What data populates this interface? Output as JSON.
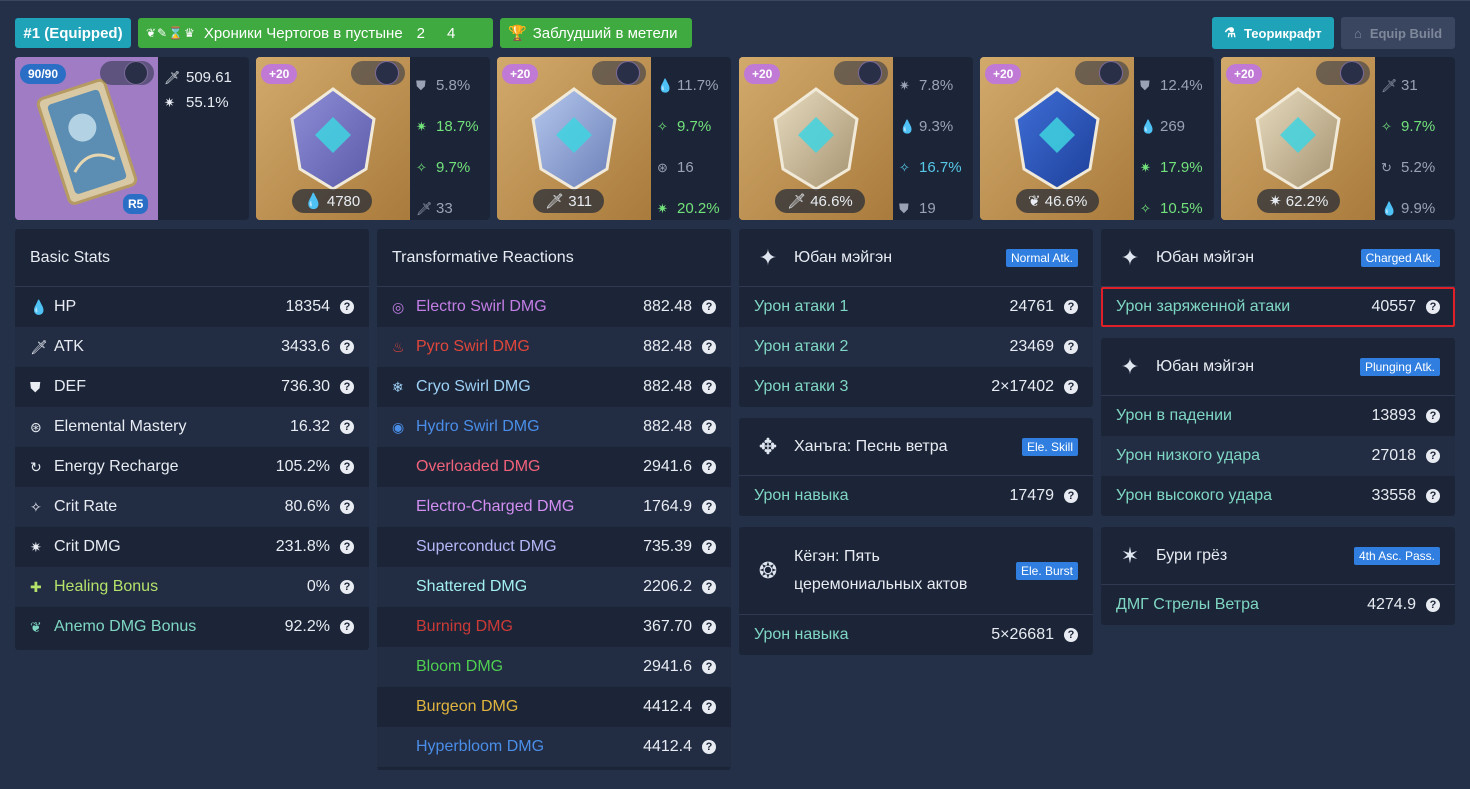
{
  "header": {
    "equipped_tag": "#1 (Equipped)",
    "set_tag": {
      "icons": "❦✎⌛♛",
      "name": "Хроники Чертогов в пустыне",
      "count_a": "2",
      "count_b": "4"
    },
    "cup_tag": {
      "icon": "🏆",
      "name": "Заблудший в метели"
    },
    "theorycraft_button": "Теорикрафт",
    "equip_build_button": "Equip Build"
  },
  "weapon": {
    "level": "90/90",
    "refinement": "R5",
    "atk": "509.61",
    "crit_dmg": "55.1%"
  },
  "artifacts": [
    {
      "level": "+20",
      "main": "4780",
      "main_icon": "hp-icon",
      "subs": [
        {
          "icon": "def-icon",
          "value": "5.8%",
          "style": "dim"
        },
        {
          "icon": "crit-dmg-icon",
          "value": "18.7%",
          "style": "hi"
        },
        {
          "icon": "crit-rate-icon",
          "value": "9.7%",
          "style": "hi"
        },
        {
          "icon": "atk-icon",
          "value": "33",
          "style": "dim"
        }
      ]
    },
    {
      "level": "+20",
      "main": "311",
      "main_icon": "atk-icon",
      "subs": [
        {
          "icon": "hp-icon",
          "value": "11.7%",
          "style": "dim"
        },
        {
          "icon": "crit-rate-icon",
          "value": "9.7%",
          "style": "hi"
        },
        {
          "icon": "em-icon",
          "value": "16",
          "style": "dim"
        },
        {
          "icon": "crit-dmg-icon",
          "value": "20.2%",
          "style": "hi"
        }
      ]
    },
    {
      "level": "+20",
      "main": "46.6%",
      "main_icon": "atk-icon",
      "subs": [
        {
          "icon": "crit-dmg-icon",
          "value": "7.8%",
          "style": "dim"
        },
        {
          "icon": "hp-icon",
          "value": "9.3%",
          "style": "dim"
        },
        {
          "icon": "crit-rate-icon",
          "value": "16.7%",
          "style": "hi2"
        },
        {
          "icon": "def-icon",
          "value": "19",
          "style": "dim"
        }
      ]
    },
    {
      "level": "+20",
      "main": "46.6%",
      "main_icon": "anemo-icon",
      "subs": [
        {
          "icon": "def-icon",
          "value": "12.4%",
          "style": "dim"
        },
        {
          "icon": "hp-icon",
          "value": "269",
          "style": "dim"
        },
        {
          "icon": "crit-dmg-icon",
          "value": "17.9%",
          "style": "hi"
        },
        {
          "icon": "crit-rate-icon",
          "value": "10.5%",
          "style": "hi"
        }
      ]
    },
    {
      "level": "+20",
      "main": "62.2%",
      "main_icon": "crit-dmg-icon",
      "subs": [
        {
          "icon": "atk-icon",
          "value": "31",
          "style": "dim"
        },
        {
          "icon": "crit-rate-icon",
          "value": "9.7%",
          "style": "hi"
        },
        {
          "icon": "er-icon",
          "value": "5.2%",
          "style": "dim"
        },
        {
          "icon": "hp-icon",
          "value": "9.9%",
          "style": "dim"
        }
      ]
    }
  ],
  "basic_stats": {
    "title": "Basic Stats",
    "rows": [
      {
        "icon": "hp-icon",
        "label": "HP",
        "value": "18354",
        "color": "#e8ecf2"
      },
      {
        "icon": "atk-icon",
        "label": "ATK",
        "value": "3433.6",
        "color": "#e8ecf2"
      },
      {
        "icon": "def-icon",
        "label": "DEF",
        "value": "736.30",
        "color": "#e8ecf2"
      },
      {
        "icon": "em-icon",
        "label": "Elemental Mastery",
        "value": "16.32",
        "color": "#e8ecf2"
      },
      {
        "icon": "er-icon",
        "label": "Energy Recharge",
        "value": "105.2%",
        "color": "#e8ecf2"
      },
      {
        "icon": "crit-rate-icon",
        "label": "Crit Rate",
        "value": "80.6%",
        "color": "#e8ecf2"
      },
      {
        "icon": "crit-dmg-icon",
        "label": "Crit DMG",
        "value": "231.8%",
        "color": "#e8ecf2"
      },
      {
        "icon": "healing-icon",
        "label": "Healing Bonus",
        "value": "0%",
        "color": "#b4e26a"
      },
      {
        "icon": "anemo-icon",
        "label": "Anemo DMG Bonus",
        "value": "92.2%",
        "color": "#7fd7c3"
      }
    ]
  },
  "reactions": {
    "title": "Transformative Reactions",
    "rows": [
      {
        "icon": "electro-swirl-icon",
        "label": "Electro Swirl DMG",
        "value": "882.48",
        "color": "#c37ee6"
      },
      {
        "icon": "pyro-swirl-icon",
        "label": "Pyro Swirl DMG",
        "value": "882.48",
        "color": "#e0463a"
      },
      {
        "icon": "cryo-swirl-icon",
        "label": "Cryo Swirl DMG",
        "value": "882.48",
        "color": "#9ed0f5"
      },
      {
        "icon": "hydro-swirl-icon",
        "label": "Hydro Swirl DMG",
        "value": "882.48",
        "color": "#4a8ee8"
      },
      {
        "icon": "",
        "label": "Overloaded DMG",
        "value": "2941.6",
        "color": "#f2627a"
      },
      {
        "icon": "",
        "label": "Electro-Charged DMG",
        "value": "1764.9",
        "color": "#d38ff2"
      },
      {
        "icon": "",
        "label": "Superconduct DMG",
        "value": "735.39",
        "color": "#b4b8f8"
      },
      {
        "icon": "",
        "label": "Shattered DMG",
        "value": "2206.2",
        "color": "#a3f0f0"
      },
      {
        "icon": "",
        "label": "Burning DMG",
        "value": "367.70",
        "color": "#cc3a36"
      },
      {
        "icon": "",
        "label": "Bloom DMG",
        "value": "2941.6",
        "color": "#4fcf4f"
      },
      {
        "icon": "",
        "label": "Burgeon DMG",
        "value": "4412.4",
        "color": "#e0b43e"
      },
      {
        "icon": "",
        "label": "Hyperbloom DMG",
        "value": "4412.4",
        "color": "#4a8ee8"
      }
    ]
  },
  "talents": [
    {
      "name": "Юбан мэйгэн",
      "badge": "Normal Atk.",
      "icon": "bow-talent-icon",
      "rows": [
        {
          "label": "Урон атаки 1",
          "value": "24761"
        },
        {
          "label": "Урон атаки 2",
          "value": "23469"
        },
        {
          "label": "Урон атаки 3",
          "value": "2×17402"
        }
      ]
    },
    {
      "name": "Ханъга: Песнь ветра",
      "badge": "Ele. Skill",
      "icon": "skill-icon",
      "rows": [
        {
          "label": "Урон навыка",
          "value": "17479"
        }
      ]
    },
    {
      "name_line1": "Кёгэн: Пять",
      "name_line2": "церемониальных актов",
      "badge": "Ele. Burst",
      "icon": "burst-icon",
      "rows": [
        {
          "label": "Урон навыка",
          "value": "5×26681"
        }
      ]
    },
    {
      "name": "Юбан мэйгэн",
      "badge": "Charged Atk.",
      "icon": "bow-talent-icon",
      "rows": [
        {
          "label": "Урон заряженной атаки",
          "value": "40557"
        }
      ]
    },
    {
      "name": "Юбан мэйгэн",
      "badge": "Plunging Atk.",
      "icon": "bow-talent-icon",
      "rows": [
        {
          "label": "Урон в падении",
          "value": "13893"
        },
        {
          "label": "Урон низкого удара",
          "value": "27018"
        },
        {
          "label": "Урон высокого удара",
          "value": "33558"
        }
      ]
    },
    {
      "name": "Бури грёз",
      "badge": "4th Asc. Pass.",
      "icon": "passive-icon",
      "rows": [
        {
          "label": "ДМГ Стрелы Ветра",
          "value": "4274.9"
        }
      ]
    }
  ],
  "help_glyph": "?"
}
